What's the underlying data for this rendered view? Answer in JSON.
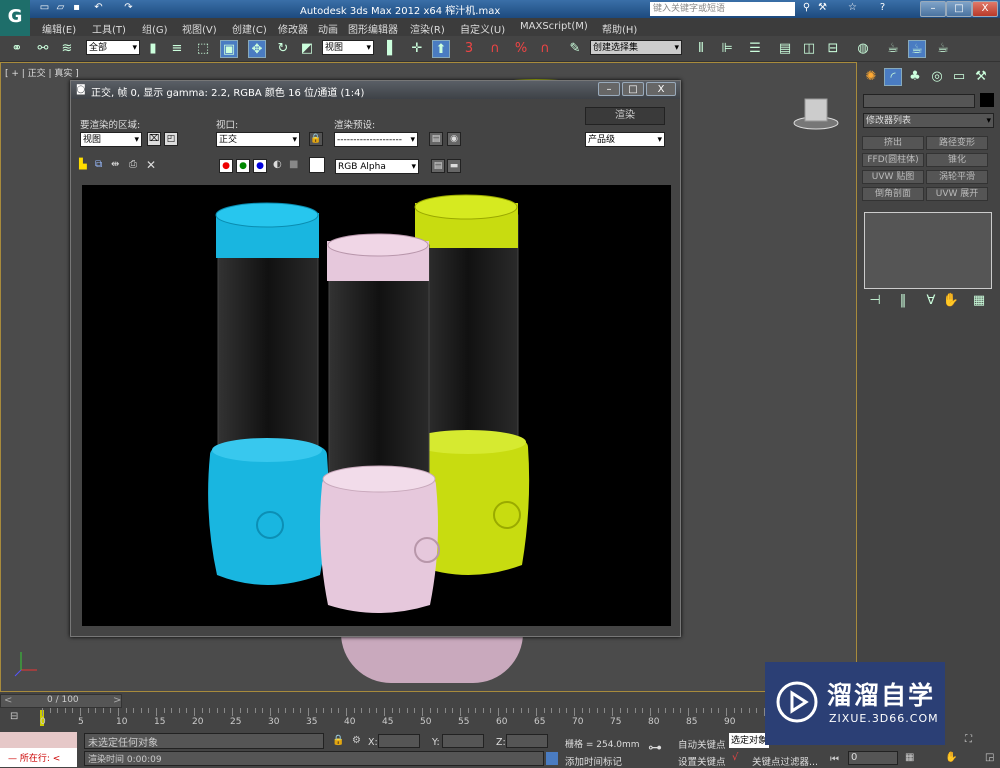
{
  "title_bar": {
    "title": "Autodesk 3ds Max  2012 x64      榨汁机.max",
    "search_placeholder": "键入关键字或短语",
    "app_logo": "G"
  },
  "menu": [
    "编辑(E)",
    "工具(T)",
    "组(G)",
    "视图(V)",
    "创建(C)",
    "修改器",
    "动画",
    "图形编辑器",
    "渲染(R)",
    "自定义(U)",
    "MAXScript(M)",
    "帮助(H)"
  ],
  "toolbar": {
    "selection_filter": "全部",
    "reference_coord": "视图",
    "named_selection": "创建选择集",
    "snap_3": "3",
    "snap_pct": "%"
  },
  "viewport": {
    "label": "[ + | 正交 | 真实 ]"
  },
  "render_dialog": {
    "title": "正交, 帧 0, 显示 gamma: 2.2, RGBA 颜色 16 位/通道 (1:4)",
    "area_label": "要渲染的区域:",
    "area_value": "视图",
    "viewport_label": "视口:",
    "viewport_value": "正交",
    "preset_label": "渲染预设:",
    "preset_value": "--------------------",
    "render_button": "渲染",
    "quality_value": "产品级",
    "channel_value": "RGB Alpha"
  },
  "command_panel": {
    "modifier_list": "修改器列表",
    "modifier_buttons": [
      "挤出",
      "路径变形",
      "FFD(圆柱体)",
      "锥化",
      "UVW 贴图",
      "涡轮平滑",
      "倒角剖面",
      "UVW 展开"
    ]
  },
  "timeline": {
    "frame": "0 / 100",
    "ticks": [
      "0",
      "5",
      "10",
      "15",
      "20",
      "25",
      "30",
      "35",
      "40",
      "45",
      "50",
      "55",
      "60",
      "65",
      "70",
      "75",
      "80",
      "85",
      "90"
    ]
  },
  "status": {
    "selection": "未选定任何对象",
    "render_time": "渲染时间  0:00:09",
    "x_label": "X:",
    "y_label": "Y:",
    "z_label": "Z:",
    "grid": "栅格 = 254.0mm",
    "add_time_tag": "添加时间标记",
    "auto_key": "自动关键点",
    "selected": "选定对象",
    "set_key": "设置关键点",
    "key_filters": "关键点过滤器...",
    "frame_input": "0",
    "script_label": "所在行:"
  },
  "watermark": {
    "brand": "溜溜自学",
    "url": "ZIXUE.3D66.COM"
  },
  "colors": {
    "cyan": "#19b6e0",
    "pink": "#e6c8dc",
    "yellow": "#c8dc10",
    "accent": "#4a7cc2"
  }
}
